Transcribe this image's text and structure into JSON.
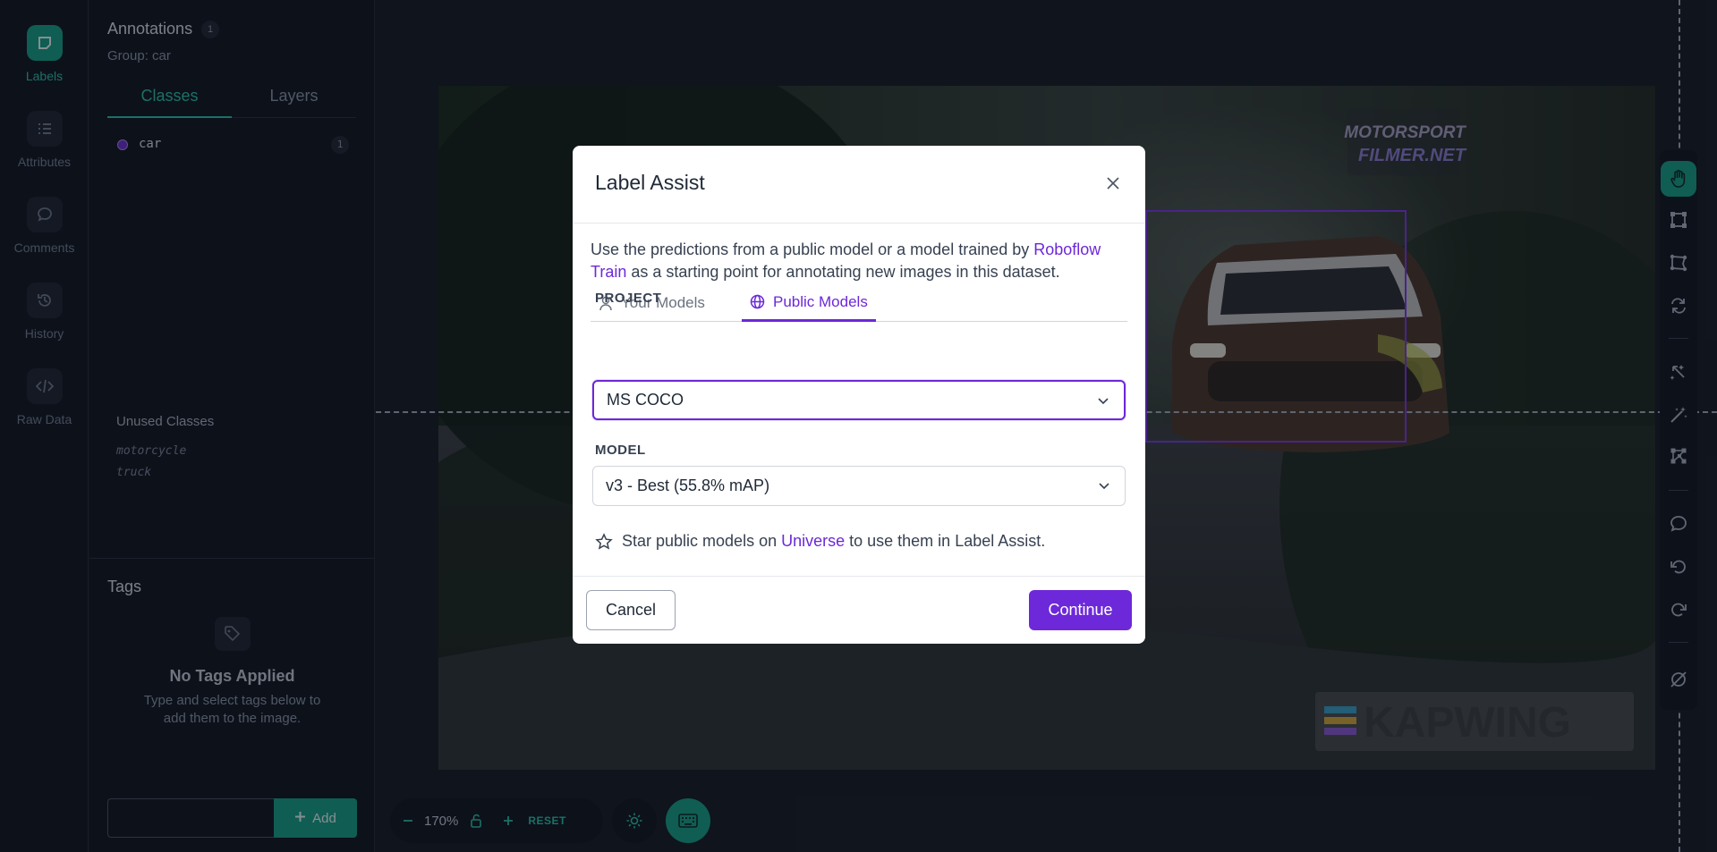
{
  "rail": {
    "items": [
      {
        "label": "Labels"
      },
      {
        "label": "Attributes"
      },
      {
        "label": "Comments"
      },
      {
        "label": "History"
      },
      {
        "label": "Raw Data"
      }
    ]
  },
  "panel": {
    "title": "Annotations",
    "title_count": "1",
    "group": "Group: car",
    "tabs": {
      "classes": "Classes",
      "layers": "Layers"
    },
    "classes": [
      {
        "name": "car",
        "count": "1",
        "color": "#6d2ed2"
      }
    ],
    "unused_title": "Unused Classes",
    "unused": [
      "motorcycle",
      "truck"
    ],
    "tags": {
      "title": "Tags",
      "empty_title": "No Tags Applied",
      "empty_desc": "Type and select tags below to add them to the image.",
      "add_label": "Add",
      "input_value": ""
    }
  },
  "canvas": {
    "watermark_top": "MOTORSPORT",
    "watermark_top2": "FILMER.NET",
    "watermark_bottom": "KAPWING",
    "box_color": "#7c3aed"
  },
  "zoom": {
    "level": "170%",
    "reset": "RESET"
  },
  "modal": {
    "title": "Label Assist",
    "desc_before": "Use the predictions from a public model or a model trained by ",
    "desc_link": "Roboflow Train",
    "desc_after": " as a starting point for annotating new images in this dataset.",
    "tabs": {
      "your": "Your Models",
      "public": "Public Models"
    },
    "project_label": "PROJECT",
    "project_value": "MS COCO",
    "model_label": "MODEL",
    "model_value": "v3 - Best (55.8% mAP)",
    "star_before": "Star public models on ",
    "star_link": "Universe",
    "star_after": " to use them in Label Assist.",
    "cancel": "Cancel",
    "continue": "Continue"
  },
  "colors": {
    "accent": "#17a08a",
    "purple": "#6d28d9",
    "sidebar_bg": "#111722",
    "canvas_bg": "#161c27"
  }
}
